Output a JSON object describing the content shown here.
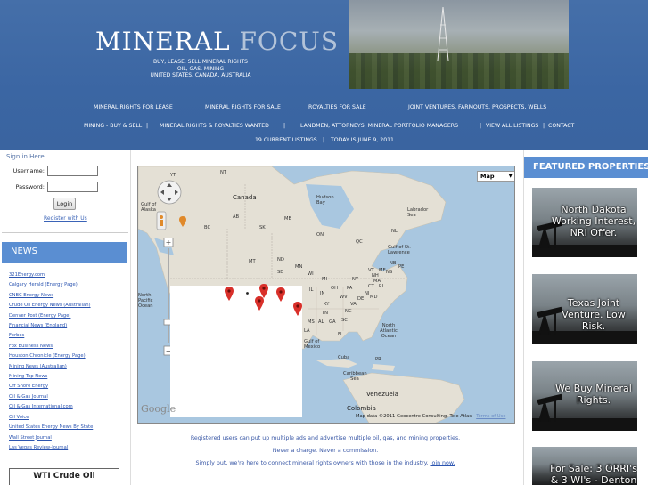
{
  "header": {
    "logo_word1": "MINERAL",
    "logo_word2": "FOCUS",
    "tagline1": "BUY, LEASE, SELL MINERAL RIGHTS",
    "tagline2": "OIL, GAS, MINING",
    "tagline3": "UNITED STATES, CANADA, AUSTRALIA"
  },
  "nav": {
    "row1": [
      "MINERAL RIGHTS FOR LEASE",
      "MINERAL RIGHTS FOR SALE",
      "ROYALTIES FOR SALE",
      "JOINT VENTURES, FARMOUTS, PROSPECTS, WELLS"
    ],
    "row2": [
      "MINING - BUY & SELL",
      "MINERAL RIGHTS & ROYALTIES WANTED",
      "LANDMEN, ATTORNEYS, MINERAL PORTFOLIO MANAGERS",
      "VIEW ALL LISTINGS",
      "CONTACT"
    ],
    "listings": "19 CURRENT LISTINGS",
    "today": "TODAY IS JUNE 9, 2011",
    "sep": "|"
  },
  "signin": {
    "title": "Sign in Here",
    "username_label": "Username:",
    "password_label": "Password:",
    "login_label": "Login",
    "register_link": "Register with Us"
  },
  "news": {
    "title": "NEWS",
    "links": [
      "321Energy.com",
      "Calgary Herald (Energy Page)",
      "CNBC Energy News",
      "Crude Oil Energy News (Australian)",
      "Denver Post (Energy Page)",
      "Financial News (England)",
      "Forbes",
      "Fox Business News",
      "Houston Chronicle (Energy Page)",
      "Mining News (Australian)",
      "Mining Top News",
      "Off Shore Energy",
      "Oil & Gas Journal",
      "Oil & Gas International.com",
      "Oil Voice",
      "United States Energy News By State",
      "Wall Street Journal",
      "Las Vegas Review-Journal"
    ],
    "wti_title": "WTI Crude Oil"
  },
  "map": {
    "type_label": "Map",
    "credit": "Map data ©2011 Geocentre Consulting, Tele Atlas -",
    "terms": "Terms of Use",
    "google": "Google",
    "labels": {
      "yt": "YT",
      "nt": "NT",
      "gulf_alaska": "Gulf of Alaska",
      "canada": "Canada",
      "hudson_bay": "Hudson Bay",
      "labrador_sea": "Labrador Sea",
      "nl": "NL",
      "bc": "BC",
      "ab": "AB",
      "sk": "SK",
      "mb": "MB",
      "on": "ON",
      "qc": "QC",
      "gulf_st_lawrence": "Gulf of St. Lawrence",
      "mt": "MT",
      "nd": "ND",
      "sd": "SD",
      "mn": "MN",
      "wi": "WI",
      "mi": "MI",
      "vt": "VT",
      "me": "ME",
      "nb": "NB",
      "pe": "PE",
      "ny": "NY",
      "nh": "NH",
      "ns": "NS",
      "ma": "MA",
      "ri": "RI",
      "ct": "CT",
      "il": "IL",
      "in": "IN",
      "oh": "OH",
      "pa": "PA",
      "nj": "NJ",
      "wv": "WV",
      "va": "VA",
      "ky": "KY",
      "de": "DE",
      "md": "MD",
      "nc": "NC",
      "tn": "TN",
      "sc": "SC",
      "ms": "MS",
      "al": "AL",
      "ga": "GA",
      "la": "LA",
      "fl": "FL",
      "north_pacific": "North Pacific Ocean",
      "gulf_mexico": "Gulf of Mexico",
      "north_atlantic": "North Atlantic Ocean",
      "cuba": "Cuba",
      "pr": "PR",
      "caribbean": "Caribbean Sea",
      "venezuela": "Venezuela",
      "colombia": "Colombia"
    }
  },
  "info": {
    "line1": "Registered users can put up multiple ads and advertise multiple oil, gas, and mining properties.",
    "line2": "Never a charge. Never a commission.",
    "line3_pre": "Simply put, we're here to connect mineral rights owners with those in the industry.",
    "join": "Join now."
  },
  "featured": {
    "title": "FEATURED PROPERTIES",
    "items": [
      "North Dakota Working Interest, NRI Offer.",
      "Texas Joint Venture. Low Risk.",
      "We Buy Mineral Rights.",
      "For Sale: 3 ORRI's & 3 WI's - Denton"
    ]
  },
  "colors": {
    "header_blue": "#3b66a3",
    "section_head": "#5a8ed2",
    "link_blue": "#2b54b0",
    "pin_red": "#d9302a"
  }
}
